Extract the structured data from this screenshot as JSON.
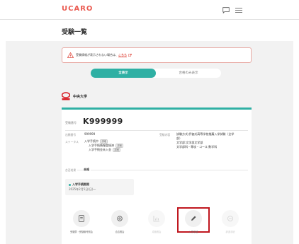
{
  "header": {
    "logo_text": "UCARO",
    "chat_icon": "chat-icon",
    "menu_icon": "hamburger-menu-icon"
  },
  "page": {
    "title": "受験一覧"
  },
  "alert": {
    "text": "受験情報が表示されない場合は、",
    "link": "こちら",
    "icon": "warning-icon"
  },
  "toggle": {
    "active": "全表示",
    "inactive": "合格のみ表示"
  },
  "university": {
    "name": "中央大学"
  },
  "card": {
    "exam_label": "受験番号",
    "exam_number": "K999999",
    "applicant_label": "出願番号",
    "applicant_number": "999999",
    "status_label": "ステータス",
    "statuses": [
      {
        "text": "入学手続中",
        "badge": "詳細"
      },
      {
        "text": "入学手続情報登録済",
        "badge": "詳細"
      },
      {
        "text": "入学手続金未入金",
        "badge": "詳細"
      }
    ],
    "content_label": "受験内容",
    "content_lines": [
      "試験方式:評価式高等学校推薦入学試験（全学",
      "部）",
      "文学部:文学部文学部",
      "文学部科・専攻・コース:数学科"
    ],
    "result_label": "合否結果",
    "result_value": "合格",
    "procedure_title": "入学手続期限",
    "procedure_date": "2025年2月5日(日)〜"
  },
  "actions": [
    {
      "label": "受験票・受験番号照会",
      "icon": "document-icon",
      "enabled": true
    },
    {
      "label": "合否照会",
      "icon": "search-icon",
      "enabled": true
    },
    {
      "label": "成績照会",
      "icon": "chart-icon",
      "enabled": false
    },
    {
      "label": "入学手続",
      "icon": "pencil-icon",
      "enabled": true,
      "highlighted": true
    },
    {
      "label": "辞退手続",
      "icon": "minus-icon",
      "enabled": false
    }
  ],
  "colors": {
    "brand": "#ea5a50",
    "accent": "#2fb0a4",
    "highlight_border": "#c0171f"
  }
}
